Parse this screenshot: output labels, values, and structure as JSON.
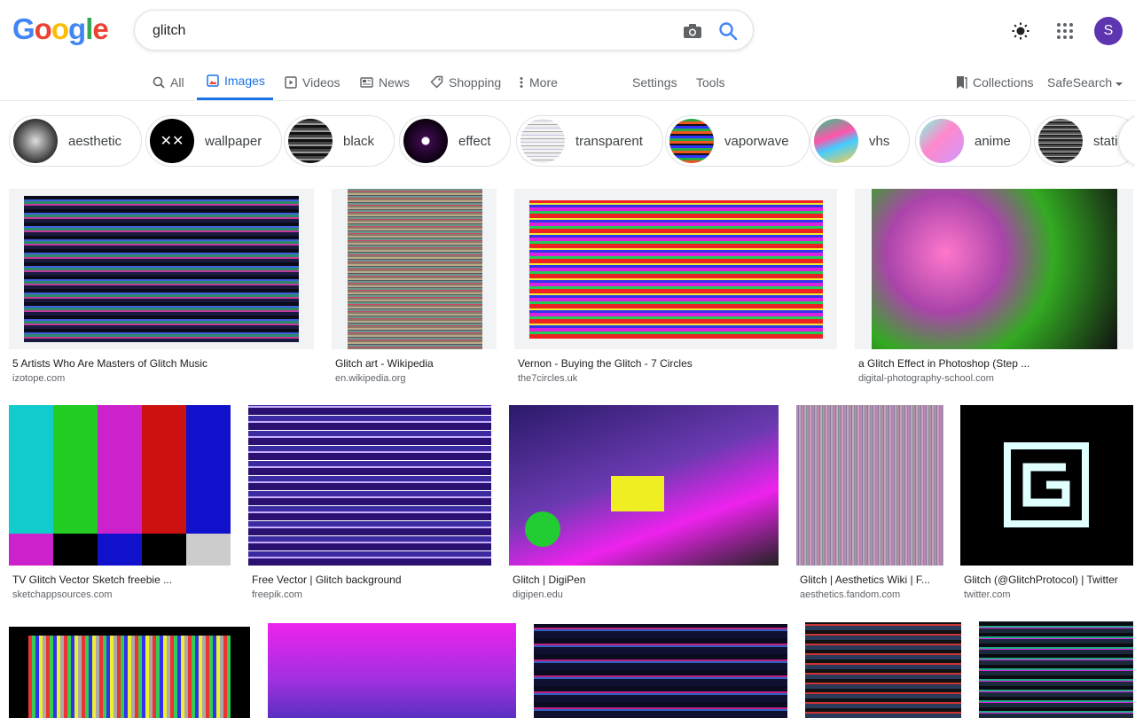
{
  "search": {
    "query": "glitch"
  },
  "account": {
    "initial": "S"
  },
  "logo_letters": [
    "G",
    "o",
    "o",
    "g",
    "l",
    "e"
  ],
  "tabs": {
    "all": "All",
    "images": "Images",
    "videos": "Videos",
    "news": "News",
    "shopping": "Shopping",
    "more": "More",
    "settings": "Settings",
    "tools": "Tools",
    "collections": "Collections",
    "safesearch": "SafeSearch"
  },
  "chips": [
    "aesthetic",
    "wallpaper",
    "black",
    "effect",
    "transparent",
    "vaporwave",
    "vhs",
    "anime",
    "stati"
  ],
  "results": [
    {
      "title": "5 Artists Who Are Masters of Glitch Music",
      "source": "izotope.com"
    },
    {
      "title": "Glitch art - Wikipedia",
      "source": "en.wikipedia.org"
    },
    {
      "title": "Vernon - Buying the Glitch - 7 Circles",
      "source": "the7circles.uk"
    },
    {
      "title": "a Glitch Effect in Photoshop (Step ...",
      "source": "digital-photography-school.com"
    },
    {
      "title": "TV Glitch Vector Sketch freebie ...",
      "source": "sketchappsources.com"
    },
    {
      "title": "Free Vector | Glitch background",
      "source": "freepik.com"
    },
    {
      "title": "Glitch | DigiPen",
      "source": "digipen.edu"
    },
    {
      "title": "Glitch | Aesthetics Wiki | F...",
      "source": "aesthetics.fandom.com"
    },
    {
      "title": "Glitch (@GlitchProtocol) | Twitter",
      "source": "twitter.com"
    }
  ],
  "colors": {
    "accent": "#1a73e8",
    "avatar": "#5e35b1"
  }
}
